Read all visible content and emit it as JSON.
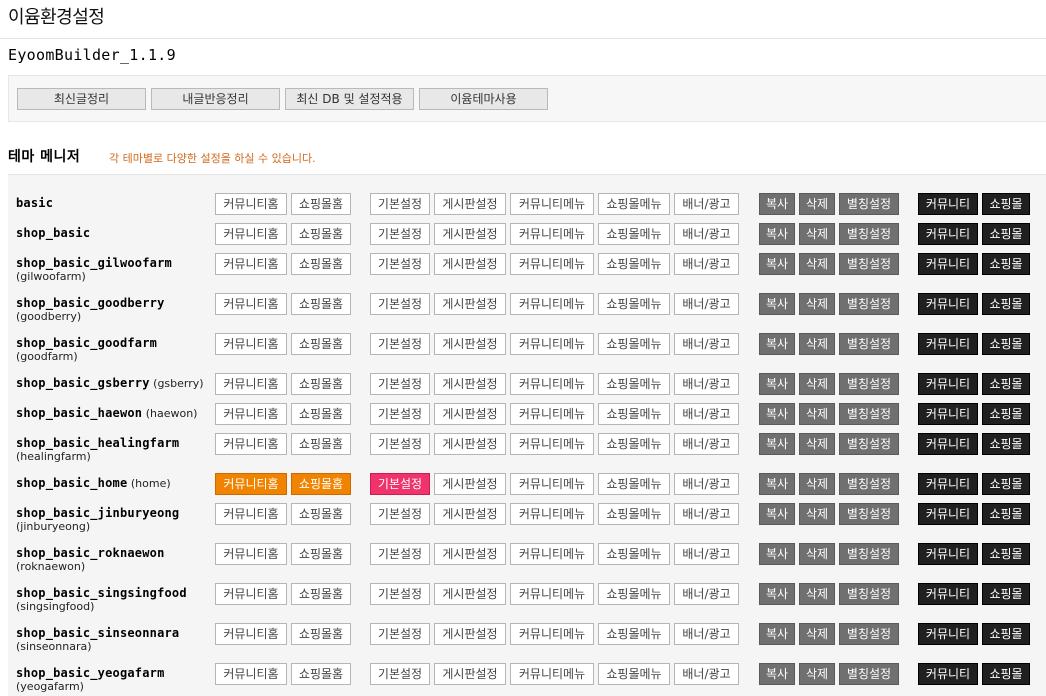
{
  "page_title": "이윰환경설정",
  "version": "EyoomBuilder_1.1.9",
  "actions": [
    "최신글정리",
    "내글반응정리",
    "최신 DB 및 설정적용",
    "이윰테마사용"
  ],
  "section": {
    "title": "테마 메니저",
    "description": "각 테마별로 다양한 설정을 하실 수 있습니다."
  },
  "buttons": {
    "community_home": "커뮤니티홈",
    "shop_home": "쇼핑몰홈",
    "basic_settings": "기본설정",
    "board_settings": "게시판설정",
    "community_menu": "커뮤니티메뉴",
    "shop_menu": "쇼핑몰메뉴",
    "banner_ad": "배너/광고",
    "copy": "복사",
    "delete": "삭제",
    "alias_settings": "별칭설정",
    "community": "커뮤니티",
    "shop": "쇼핑몰"
  },
  "colors": {
    "active_home": "#f08300",
    "active_basic": "#f0336b",
    "desc_text": "#d2691e"
  },
  "themes": [
    {
      "name": "basic",
      "alias": "",
      "active": false
    },
    {
      "name": "shop_basic",
      "alias": "",
      "active": false
    },
    {
      "name": "shop_basic_gilwoofarm",
      "alias": "(gilwoofarm)",
      "active": false
    },
    {
      "name": "shop_basic_goodberry",
      "alias": "(goodberry)",
      "active": false
    },
    {
      "name": "shop_basic_goodfarm",
      "alias": "(goodfarm)",
      "active": false
    },
    {
      "name": "shop_basic_gsberry",
      "alias": "(gsberry)",
      "active": false
    },
    {
      "name": "shop_basic_haewon",
      "alias": "(haewon)",
      "active": false
    },
    {
      "name": "shop_basic_healingfarm",
      "alias": "(healingfarm)",
      "active": false
    },
    {
      "name": "shop_basic_home",
      "alias": "(home)",
      "active": true
    },
    {
      "name": "shop_basic_jinburyeong",
      "alias": "(jinburyeong)",
      "active": false
    },
    {
      "name": "shop_basic_roknaewon",
      "alias": "(roknaewon)",
      "active": false
    },
    {
      "name": "shop_basic_singsingfood",
      "alias": "(singsingfood)",
      "active": false
    },
    {
      "name": "shop_basic_sinseonnara",
      "alias": "(sinseonnara)",
      "active": false
    },
    {
      "name": "shop_basic_yeogafarm",
      "alias": "(yeogafarm)",
      "active": false
    }
  ]
}
